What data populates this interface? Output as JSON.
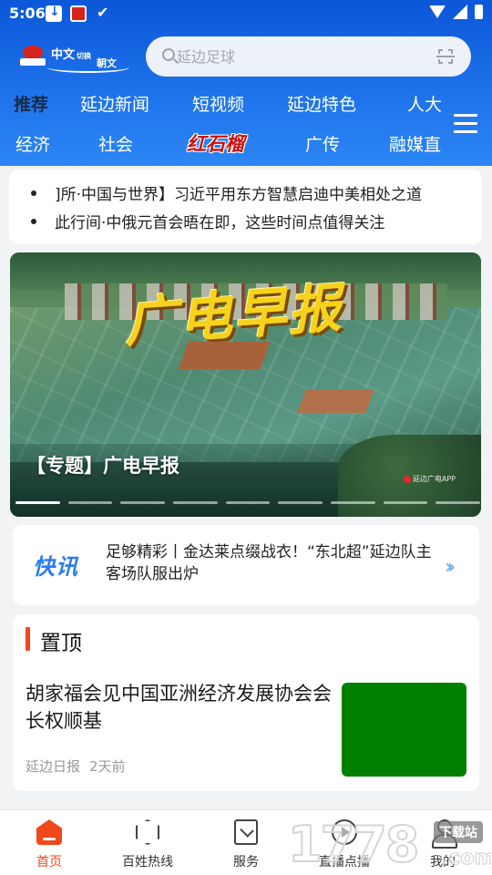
{
  "status_bar": {
    "time": "5:06",
    "left_icons": [
      "download-icon",
      "app-notification-icon",
      "check-icon"
    ],
    "right_icons": [
      "wifi-icon",
      "signal-icon",
      "battery-icon"
    ]
  },
  "header": {
    "logo": {
      "text_cn": "中文",
      "switch": "切换",
      "text_kr": "朝文"
    },
    "search": {
      "placeholder": "延边足球",
      "value": ""
    }
  },
  "channels": {
    "row1": [
      "推荐",
      "延边新闻",
      "短视频",
      "延边特色",
      "人大"
    ],
    "row2": [
      "经济",
      "社会",
      "红石榴",
      "广传",
      "融媒直"
    ],
    "active": "推荐",
    "special": "红石榴"
  },
  "ticker": {
    "items": [
      "]所·中国与世界】习近平用东方智慧启迪中美相处之道",
      "此行间·中俄元首会晤在即，这些时间点值得关注"
    ]
  },
  "banner": {
    "art_title": "广电早报",
    "caption": "【专题】广电早报",
    "watermark": "延边广电APP",
    "slide_count": 9,
    "active_slide": 1
  },
  "flash_news": {
    "label": "快讯",
    "text": "足够精彩丨金达莱点缀战衣！“东北超”延边队主客场队服出炉"
  },
  "pinned": {
    "section_title": "置顶",
    "article": {
      "title": "胡家福会见中国亚洲经济发展协会会长权顺基",
      "source": "延边日报",
      "time": "2天前",
      "thumb_color": "#008000"
    }
  },
  "bottom_nav": {
    "items": [
      {
        "label": "首页",
        "icon": "home-icon",
        "active": true
      },
      {
        "label": "百姓热线",
        "icon": "cube-icon",
        "active": false
      },
      {
        "label": "服务",
        "icon": "bookmark-icon",
        "active": false
      },
      {
        "label": "直播点播",
        "icon": "play-icon",
        "active": false
      },
      {
        "label": "我的",
        "icon": "person-icon",
        "active": false
      }
    ]
  },
  "overlay_watermark": {
    "number": "1778",
    "badge": "下载站",
    "suffix": ".com"
  },
  "colors": {
    "header_blue": "#1a66e6",
    "accent_orange": "#f0471b",
    "flash_blue": "#2c7cef"
  }
}
